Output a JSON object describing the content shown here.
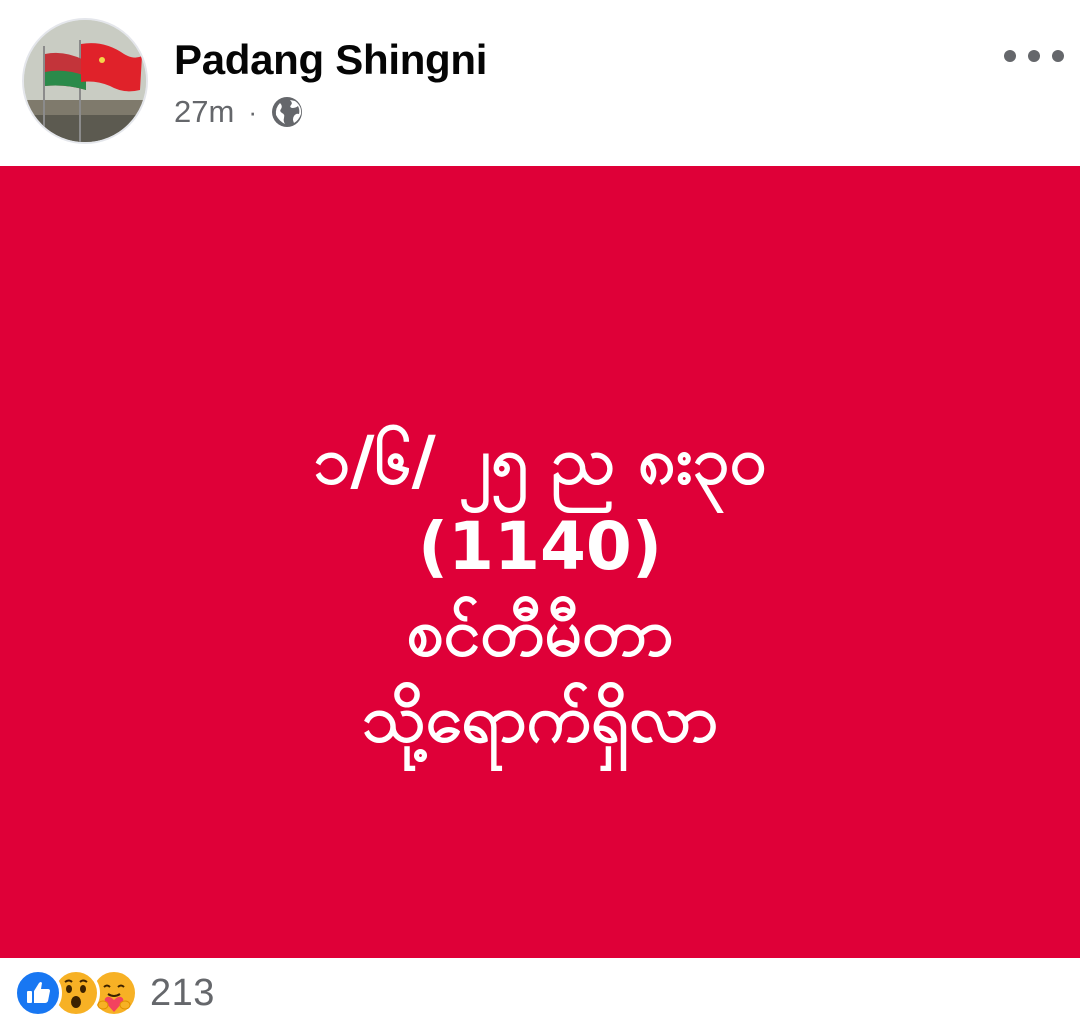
{
  "post": {
    "author": {
      "name": "Padang Shingni",
      "avatar": "profile-photo-flags"
    },
    "timestamp": "27m",
    "separator": "·",
    "privacy_icon": "globe-icon",
    "more_icon": "more-options-icon",
    "card": {
      "background_color": "#df0038",
      "text_color": "#ffffff",
      "lines": [
        "၁/၆/ ၂၅ ည ၈း၃၀",
        "(1140)",
        "စင်တီမီတာ",
        "သို့ရောက်ရှိလာ"
      ]
    },
    "reactions": {
      "icons": [
        "like-icon",
        "wow-icon",
        "care-icon"
      ],
      "count": "213"
    }
  }
}
